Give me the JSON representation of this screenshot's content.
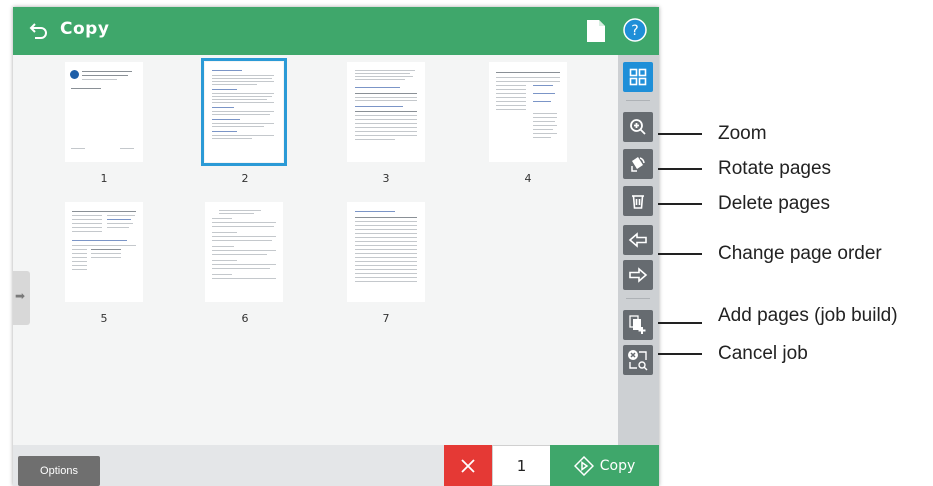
{
  "header": {
    "title": "Copy",
    "back_icon": "back-arrow-icon",
    "page_icon": "document-icon",
    "help_icon": "help-icon"
  },
  "pages": [
    {
      "label": "1",
      "selected": false
    },
    {
      "label": "2",
      "selected": true
    },
    {
      "label": "3",
      "selected": false
    },
    {
      "label": "4",
      "selected": false
    },
    {
      "label": "5",
      "selected": false
    },
    {
      "label": "6",
      "selected": false
    },
    {
      "label": "7",
      "selected": false
    }
  ],
  "toolbar": {
    "icons": [
      "grid-view-icon",
      "zoom-in-icon",
      "rotate-pages-icon",
      "delete-icon",
      "arrow-left-icon",
      "arrow-right-icon",
      "add-pages-icon",
      "cancel-job-icon"
    ]
  },
  "footer": {
    "options_label": "Options",
    "copies_value": "1",
    "copy_label": "Copy"
  },
  "callouts": {
    "zoom": "Zoom",
    "rotate": "Rotate pages",
    "delete": "Delete pages",
    "order": "Change page order",
    "add": "Add pages (job build)",
    "cancel": "Cancel job"
  },
  "colors": {
    "header": "#3fa76b",
    "selected": "#2b9ad6",
    "cancel": "#e53935",
    "copy": "#3fa76b"
  }
}
